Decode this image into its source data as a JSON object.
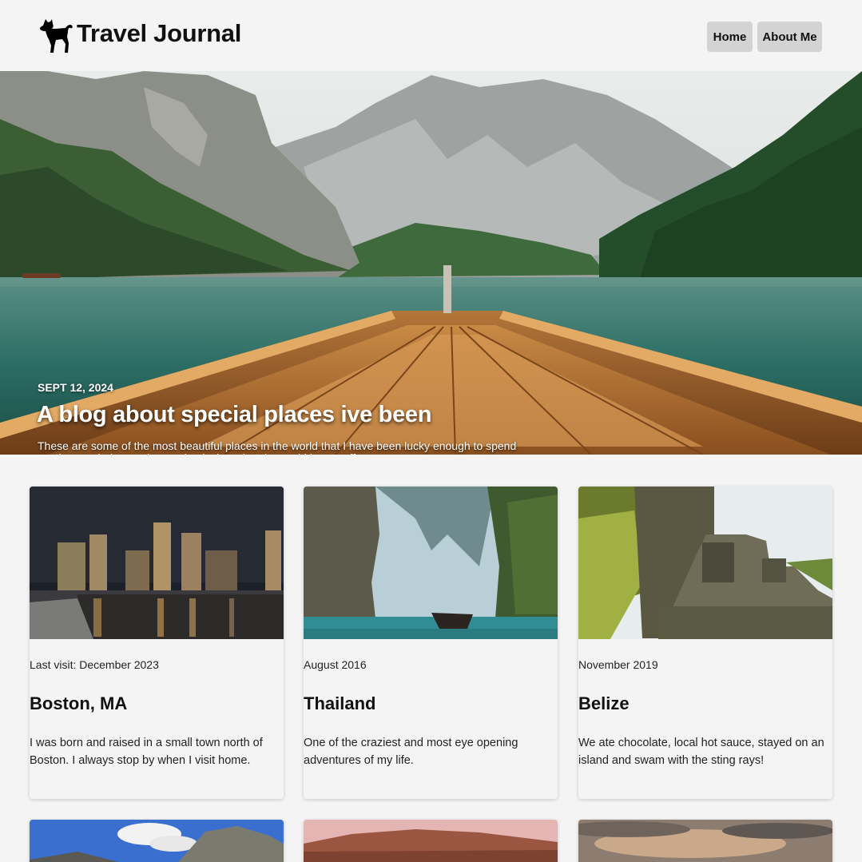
{
  "header": {
    "title": "Travel Journal",
    "logo_icon": "dog-icon",
    "nav": [
      {
        "label": "Home"
      },
      {
        "label": "About Me"
      }
    ]
  },
  "hero": {
    "date": "SEPT 12, 2024",
    "title": "A blog about special places ive been",
    "subtitle": "These are some of the most beautiful places in the world that I have been lucky enough to spend my time exploring, eating, and enjoying what the world has to offer."
  },
  "cards": [
    {
      "date": "Last visit: December 2023",
      "title": "Boston, MA",
      "description": "I was born and raised in a small town north of Boston. I always stop by when I visit home."
    },
    {
      "date": "August 2016",
      "title": "Thailand",
      "description": "One of the craziest and most eye opening adventures of my life."
    },
    {
      "date": "November 2019",
      "title": "Belize",
      "description": "We ate chocolate, local hot sauce, stayed on an island and swam with the sting rays!"
    }
  ],
  "colors": {
    "background": "#f4f4f4",
    "nav_button": "#d3d3d3",
    "text": "#111111"
  }
}
